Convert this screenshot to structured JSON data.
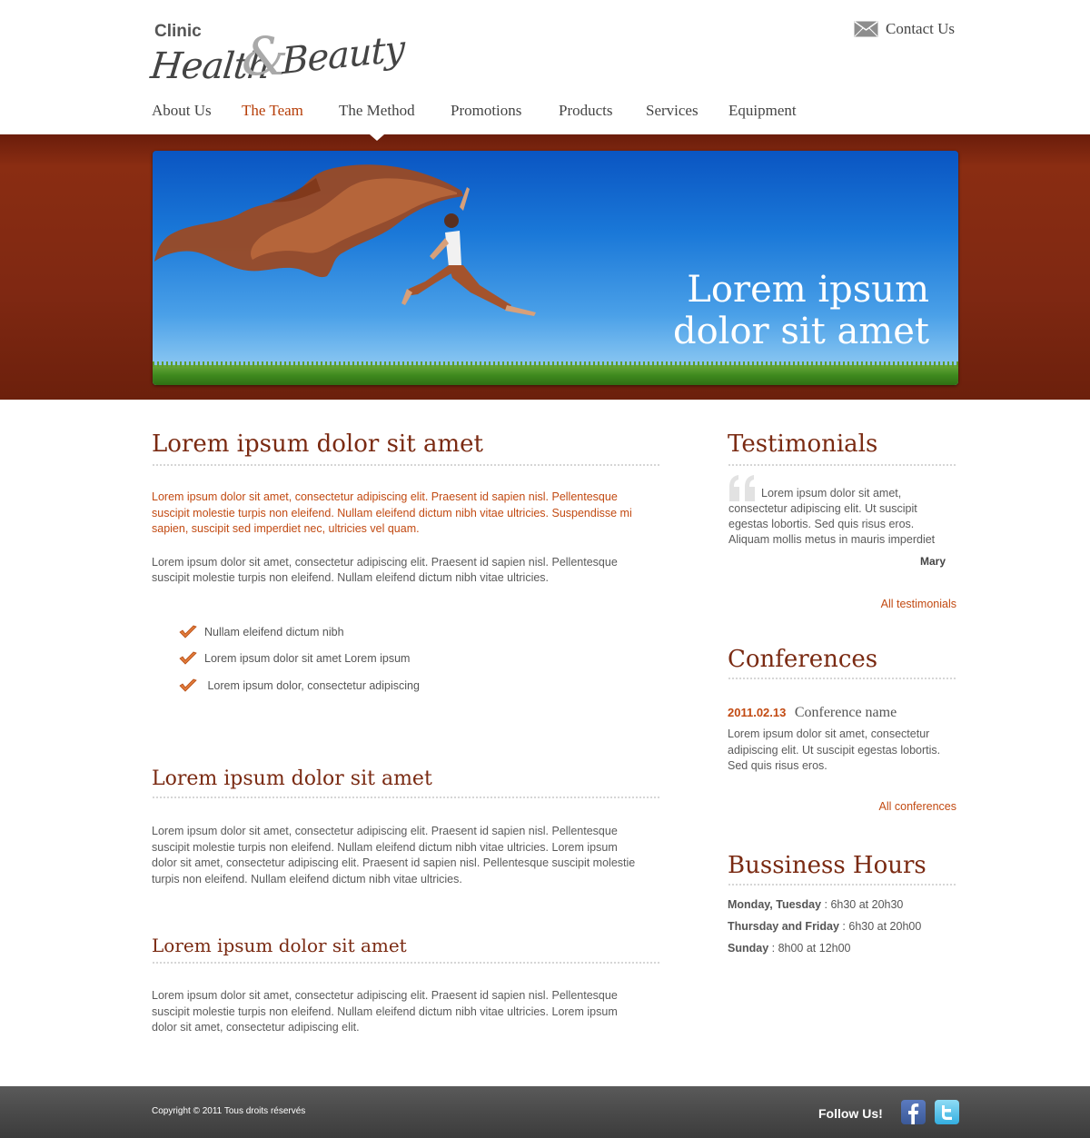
{
  "header": {
    "logo": {
      "clinic": "Clinic",
      "health": "Health",
      "amp": "&",
      "beauty": "Beauty"
    },
    "contact_label": "Contact Us",
    "nav": [
      "About Us",
      "The Team",
      "The Method",
      "Promotions",
      "Products",
      "Services",
      "Equipment"
    ],
    "nav_active": "The Team"
  },
  "banner": {
    "title_line1": "Lorem ipsum",
    "title_line2": "dolor sit amet"
  },
  "main": {
    "section1": {
      "title": "Lorem ipsum dolor sit amet",
      "intro_line1": "Lorem ipsum dolor sit amet, consectetur adipiscing elit. Praesent id sapien nisl. Pellentesque",
      "intro_line2": "suscipit molestie turpis non eleifend. Nullam eleifend dictum nibh vitae ultricies. Suspendisse mi",
      "intro_line3": "sapien, suscipit sed imperdiet nec, ultricies vel quam.",
      "body_line1": "Lorem ipsum dolor sit amet, consectetur adipiscing elit. Praesent id sapien nisl. Pellentesque",
      "body_line2": "suscipit molestie turpis non eleifend. Nullam eleifend dictum nibh vitae ultricies.",
      "checklist": [
        "Nullam eleifend dictum nibh",
        "Lorem ipsum dolor sit amet Lorem ipsum",
        " Lorem ipsum dolor, consectetur adipiscing"
      ]
    },
    "section2": {
      "title": "Lorem ipsum dolor sit amet",
      "line1": "Lorem ipsum dolor sit amet, consectetur adipiscing elit. Praesent id sapien nisl. Pellentesque",
      "line2": "suscipit molestie turpis non eleifend. Nullam eleifend dictum nibh vitae ultricies. Lorem ipsum",
      "line3": "dolor sit amet, consectetur adipiscing elit. Praesent id sapien nisl. Pellentesque suscipit molestie",
      "line4": "turpis non eleifend. Nullam eleifend dictum nibh vitae ultricies."
    },
    "section3": {
      "title": "Lorem ipsum dolor sit amet",
      "line1": "Lorem ipsum dolor sit amet, consectetur adipiscing elit. Praesent id sapien nisl. Pellentesque",
      "line2": "suscipit molestie turpis non eleifend. Nullam eleifend dictum nibh vitae ultricies. Lorem ipsum",
      "line3": "dolor sit amet, consectetur adipiscing elit."
    }
  },
  "sidebar": {
    "testimonials": {
      "title": "Testimonials",
      "line1": "Lorem ipsum dolor sit amet,",
      "line2": "consectetur adipiscing elit. Ut suscipit",
      "line3": "egestas lobortis. Sed quis risus eros.",
      "line4": "Aliquam mollis metus in mauris imperdiet",
      "author": "Mary",
      "link": "All testimonials"
    },
    "conferences": {
      "title": "Conferences",
      "date": "2011.02.13",
      "name": "Conference name",
      "line1": "Lorem ipsum dolor sit amet, consectetur",
      "line2": "adipiscing elit. Ut suscipit egestas lobortis.",
      "line3": "Sed quis risus eros.",
      "link": "All conferences"
    },
    "hours": {
      "title": "Bussiness Hours",
      "rows": [
        {
          "days": "Monday, Tuesday",
          "time": " : 6h30 at 20h30"
        },
        {
          "days": "Thursday and Friday",
          "time": " : 6h30 at 20h00"
        },
        {
          "days": "Sunday",
          "time": " : 8h00 at 12h00"
        }
      ]
    }
  },
  "footer": {
    "copyright": "Copyright © 2011 Tous droits réservés",
    "follow": "Follow Us!",
    "social": [
      "facebook-icon",
      "twitter-icon"
    ]
  },
  "colors": {
    "accent": "#b63d07",
    "heading": "#7a2a12",
    "band": "#7f2812"
  }
}
